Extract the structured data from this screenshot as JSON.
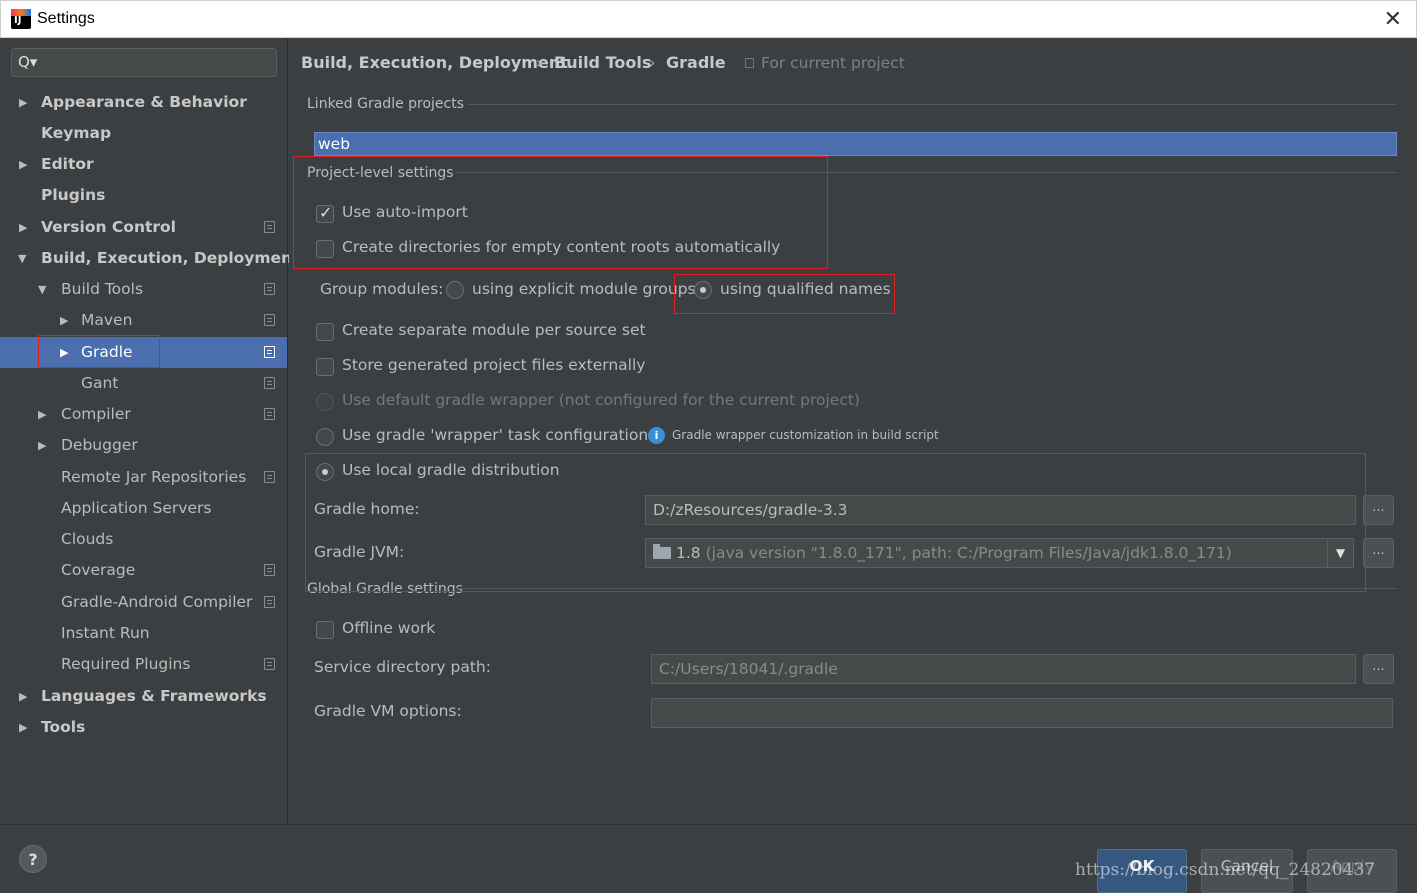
{
  "window": {
    "title": "Settings",
    "app_icon": "IJ",
    "close": "✕"
  },
  "search": {
    "icon": "Q▾",
    "placeholder": ""
  },
  "sidebar": {
    "items": [
      {
        "label": "Appearance & Behavior",
        "arrow": "▶"
      },
      {
        "label": "Keymap"
      },
      {
        "label": "Editor",
        "arrow": "▶"
      },
      {
        "label": "Plugins"
      },
      {
        "label": "Version Control",
        "arrow": "▶"
      },
      {
        "label": "Build, Execution, Deployment",
        "arrow": "▼"
      },
      {
        "label": "Build Tools",
        "arrow": "▼"
      },
      {
        "label": "Maven",
        "arrow": "▶"
      },
      {
        "label": "Gradle",
        "arrow": "▶"
      },
      {
        "label": "Gant"
      },
      {
        "label": "Compiler",
        "arrow": "▶"
      },
      {
        "label": "Debugger",
        "arrow": "▶"
      },
      {
        "label": "Remote Jar Repositories"
      },
      {
        "label": "Application Servers"
      },
      {
        "label": "Clouds"
      },
      {
        "label": "Coverage"
      },
      {
        "label": "Gradle-Android Compiler"
      },
      {
        "label": "Instant Run"
      },
      {
        "label": "Required Plugins"
      },
      {
        "label": "Languages & Frameworks",
        "arrow": "▶"
      },
      {
        "label": "Tools",
        "arrow": "▶"
      }
    ]
  },
  "breadcrumb": {
    "part1": "Build, Execution, Deployment",
    "part2": "Build Tools",
    "part3": "Gradle",
    "sep": "›",
    "scope": "For current project"
  },
  "linked": {
    "title": "Linked Gradle projects",
    "project": "web"
  },
  "project_level": {
    "title": "Project-level settings",
    "auto_import": "Use auto-import",
    "create_dirs": "Create directories for empty content roots automatically",
    "group_modules": "Group modules:",
    "explicit_groups": "using explicit module groups",
    "qualified_names": "using qualified names",
    "separate_module": "Create separate module per source set",
    "store_external": "Store generated project files externally",
    "default_wrapper": "Use default gradle wrapper (not configured for the current project)",
    "wrapper_task": "Use gradle 'wrapper' task configuration",
    "wrapper_hint_icon": "i",
    "wrapper_hint": "Gradle wrapper customization in build script",
    "local_dist": "Use local gradle distribution",
    "gradle_home_label": "Gradle home:",
    "gradle_home_value": "D:/zResources/gradle-3.3",
    "gradle_jvm_label": "Gradle JVM:",
    "gradle_jvm_version": "1.8",
    "gradle_jvm_detail": "(java version \"1.8.0_171\", path: C:/Program Files/Java/jdk1.8.0_171)"
  },
  "global": {
    "title": "Global Gradle settings",
    "offline": "Offline work",
    "service_dir_label": "Service directory path:",
    "service_dir_value": "C:/Users/18041/.gradle",
    "vm_options_label": "Gradle VM options:",
    "vm_options_value": ""
  },
  "buttons": {
    "dots": "...",
    "dropdown": "▼",
    "help": "?",
    "ok": "OK",
    "cancel": "Cancel",
    "apply": "Apply"
  },
  "watermark": "https://blog.csdn.net/qq_24820437",
  "colors": {
    "selection": "#4b6eaf",
    "background": "#3c3f41",
    "highlight_box": "#e0201f"
  }
}
